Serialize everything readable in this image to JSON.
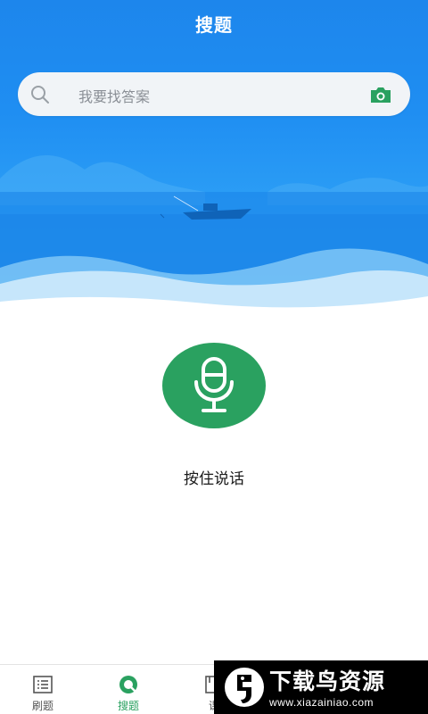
{
  "header": {
    "title": "搜题"
  },
  "search": {
    "placeholder": "我要找答案"
  },
  "voice": {
    "label": "按住说话"
  },
  "tabs": [
    {
      "label": "刷题",
      "icon": "list-icon",
      "active": false
    },
    {
      "label": "搜题",
      "icon": "search-icon",
      "active": true
    },
    {
      "label": "课",
      "icon": "book-icon",
      "active": false
    }
  ],
  "watermark": {
    "title": "下载鸟资源",
    "url": "www.xiazainiao.com"
  },
  "colors": {
    "hero_blue": "#1f8ef2",
    "accent_green": "#2aa160",
    "search_bg": "#f1f4f7"
  }
}
